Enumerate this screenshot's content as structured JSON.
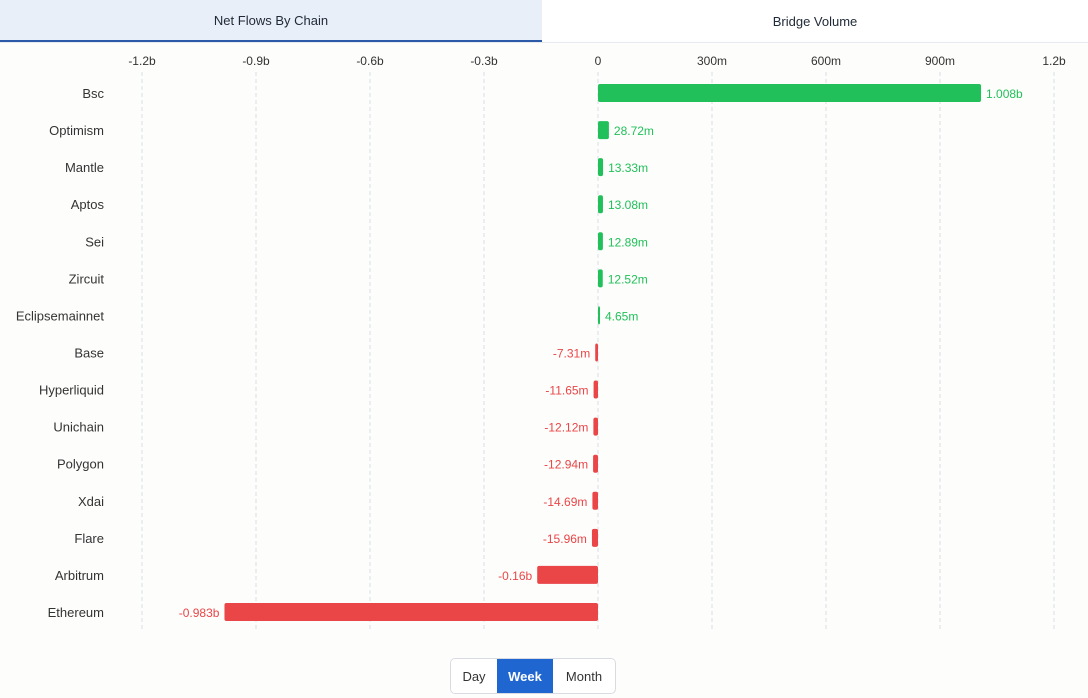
{
  "tabs": {
    "net_flows": "Net Flows By Chain",
    "bridge_volume": "Bridge Volume"
  },
  "period_toggle": {
    "options": [
      "Day",
      "Week",
      "Month"
    ],
    "selected": "Week"
  },
  "colors": {
    "positive": "#22c05a",
    "negative": "#ea4547",
    "active_tab_bg": "#e9eff9",
    "active_tab_border": "#2b5aa8",
    "toggle_active": "#1f66d1"
  },
  "chart_data": {
    "type": "bar",
    "orientation": "horizontal",
    "title": "",
    "xlabel": "",
    "ylabel": "",
    "xlim": [
      -1200000000,
      1200000000
    ],
    "grid": true,
    "x_ticks": [
      {
        "value": -1200000000,
        "label": "-1.2b"
      },
      {
        "value": -900000000,
        "label": "-0.9b"
      },
      {
        "value": -600000000,
        "label": "-0.6b"
      },
      {
        "value": -300000000,
        "label": "-0.3b"
      },
      {
        "value": 0,
        "label": "0"
      },
      {
        "value": 300000000,
        "label": "300m"
      },
      {
        "value": 600000000,
        "label": "600m"
      },
      {
        "value": 900000000,
        "label": "900m"
      },
      {
        "value": 1200000000,
        "label": "1.2b"
      }
    ],
    "categories": [
      "Bsc",
      "Optimism",
      "Mantle",
      "Aptos",
      "Sei",
      "Zircuit",
      "Eclipsemainnet",
      "Base",
      "Hyperliquid",
      "Unichain",
      "Polygon",
      "Xdai",
      "Flare",
      "Arbitrum",
      "Ethereum"
    ],
    "values": [
      1008000000,
      28720000,
      13330000,
      13080000,
      12890000,
      12520000,
      4650000,
      -7310000,
      -11650000,
      -12120000,
      -12940000,
      -14690000,
      -15960000,
      -160000000,
      -983000000
    ],
    "data_labels": [
      "1.008b",
      "28.72m",
      "13.33m",
      "13.08m",
      "12.89m",
      "12.52m",
      "4.65m",
      "-7.31m",
      "-11.65m",
      "-12.12m",
      "-12.94m",
      "-14.69m",
      "-15.96m",
      "-0.16b",
      "-0.983b"
    ]
  }
}
